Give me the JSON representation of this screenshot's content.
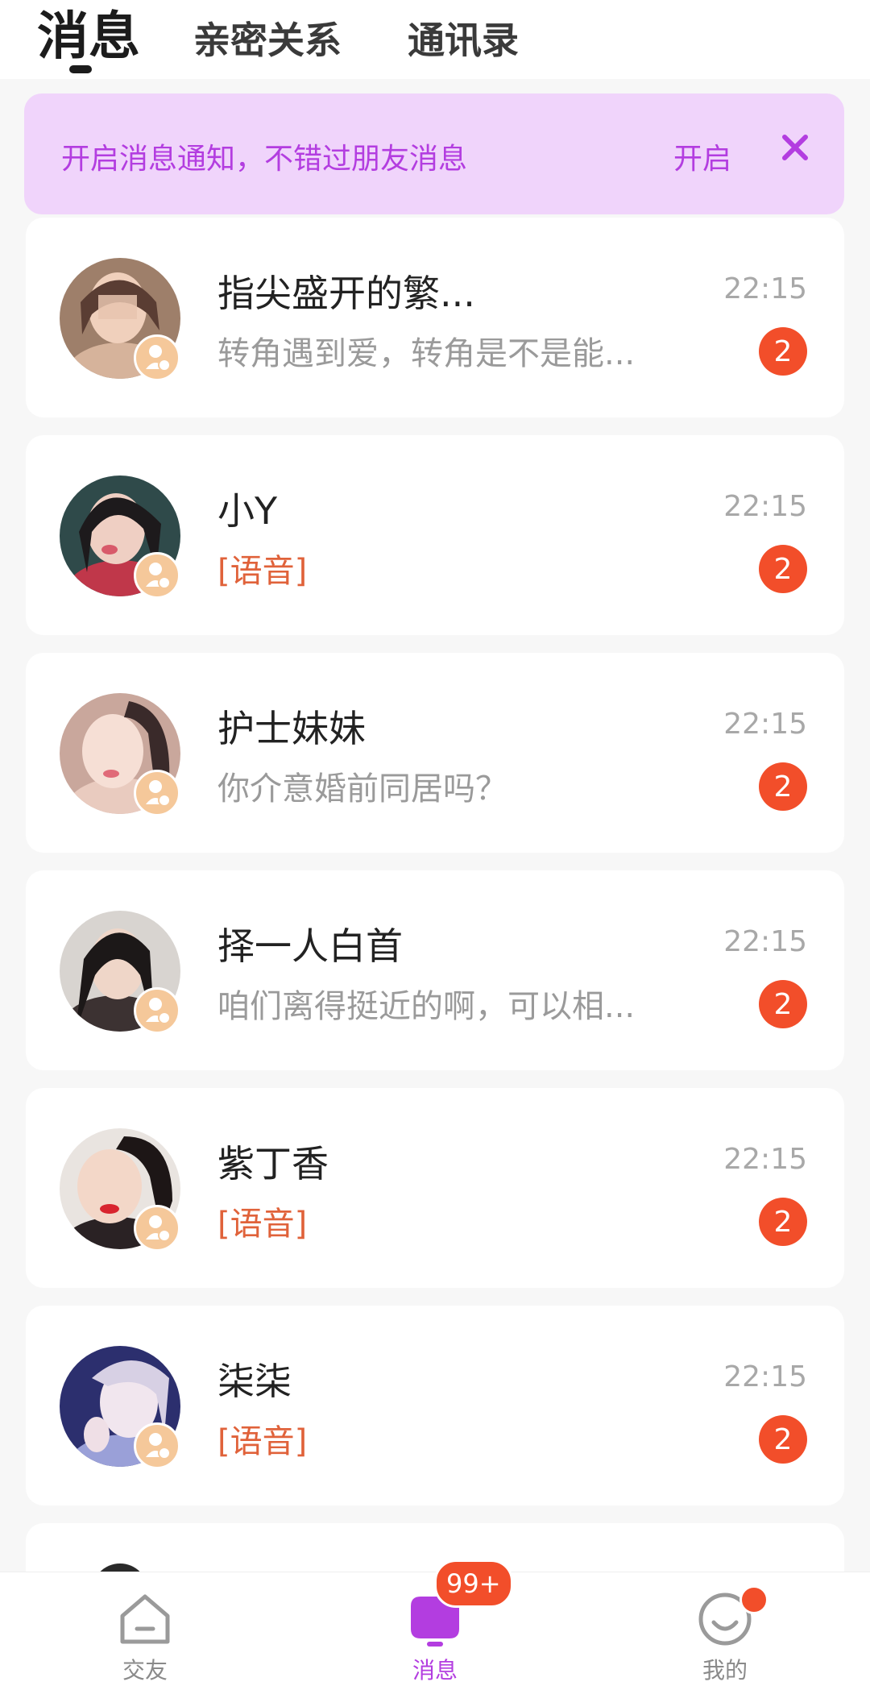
{
  "tabs": [
    {
      "label": "消息",
      "active": true
    },
    {
      "label": "亲密关系",
      "active": false
    },
    {
      "label": "通讯录",
      "active": false
    }
  ],
  "notice": {
    "text": "开启消息通知，不错过朋友消息",
    "action_label": "开启",
    "close_icon": "close-icon",
    "color": "#b33de0",
    "background": "#f0d4fb"
  },
  "chats": [
    {
      "name": "指尖盛开的繁...",
      "preview": "转角遇到爱，转角是不是能...",
      "preview_type": "text",
      "time": "22:15",
      "unread": "2"
    },
    {
      "name": "小Y",
      "preview": "[语音]",
      "preview_type": "voice",
      "time": "22:15",
      "unread": "2"
    },
    {
      "name": "护士妹妹",
      "preview": "你介意婚前同居吗？",
      "preview_type": "text",
      "time": "22:15",
      "unread": "2"
    },
    {
      "name": "择一人白首",
      "preview": "咱们离得挺近的啊，可以相...",
      "preview_type": "text",
      "time": "22:15",
      "unread": "2"
    },
    {
      "name": "紫丁香",
      "preview": "[语音]",
      "preview_type": "voice",
      "time": "22:15",
      "unread": "2"
    },
    {
      "name": "柒柒",
      "preview": "[语音]",
      "preview_type": "voice",
      "time": "22:15",
      "unread": "2"
    }
  ],
  "bottom_nav": [
    {
      "label": "交友",
      "icon": "home-icon",
      "active": false
    },
    {
      "label": "消息",
      "icon": "message-icon",
      "active": true,
      "badge": "99+"
    },
    {
      "label": "我的",
      "icon": "profile-icon",
      "active": false
    }
  ],
  "colors": {
    "accent": "#b33de0",
    "badge": "#f24e2a",
    "voice": "#e0623a",
    "verify_badge": "#f5c89a"
  }
}
